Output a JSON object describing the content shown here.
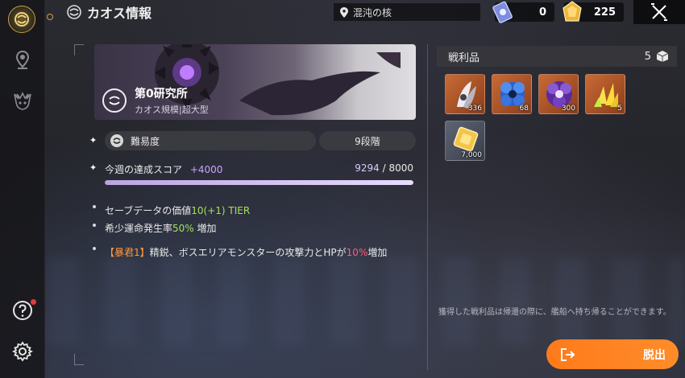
{
  "window": {
    "title": "カオス情報",
    "location": "混沌の核"
  },
  "currencies": [
    {
      "name": "ticket",
      "icon": "crystal-ticket-icon",
      "value": "0"
    },
    {
      "name": "gem",
      "icon": "gold-gem-icon",
      "value": "225"
    }
  ],
  "stage": {
    "name": "第0研究所",
    "subtitle": "カオス規模|超大型"
  },
  "difficulty": {
    "label": "難易度",
    "value": "9段階"
  },
  "score": {
    "label": "今週の達成スコア",
    "gain": "+4000",
    "current": "9294",
    "separator": "/",
    "max": "8000",
    "progress_fraction": 1.0
  },
  "bonuses": {
    "save_value_label": "セーブデータの価値",
    "save_value": "10(+1) TIER",
    "rare_fate_label": "希少運命発生率",
    "rare_fate_value": "50%",
    "rare_fate_suffix": "増加",
    "tyrant_tag": "【暴君1】",
    "tyrant_text_a": "精鋭、ボスエリアモンスターの攻撃力とHPが",
    "tyrant_value": "10%",
    "tyrant_text_b": "増加"
  },
  "loot": {
    "title": "戦利品",
    "count": "5",
    "items": [
      {
        "icon": "white-feather-material-icon",
        "qty": "336",
        "frame": "#b85a2a"
      },
      {
        "icon": "blue-flower-material-icon",
        "qty": "68",
        "frame": "#b85a2a"
      },
      {
        "icon": "purple-flower-material-icon",
        "qty": "300",
        "frame": "#b85a2a"
      },
      {
        "icon": "gold-crystal-material-icon",
        "qty": "5",
        "frame": "#b85a2a"
      },
      {
        "icon": "gold-cube-currency-icon",
        "qty": "7,000",
        "frame": "#5a6070"
      }
    ],
    "note": "獲得した戦利品は帰還の際に、艦船へ持ち帰ることができます。"
  },
  "exit": {
    "label": "脱出"
  },
  "colors": {
    "accent_orange": "#ff8225",
    "bonus_green": "#a3e05a",
    "warning_pink": "#ff5a7a",
    "score_gain": "#c8a6ff"
  }
}
